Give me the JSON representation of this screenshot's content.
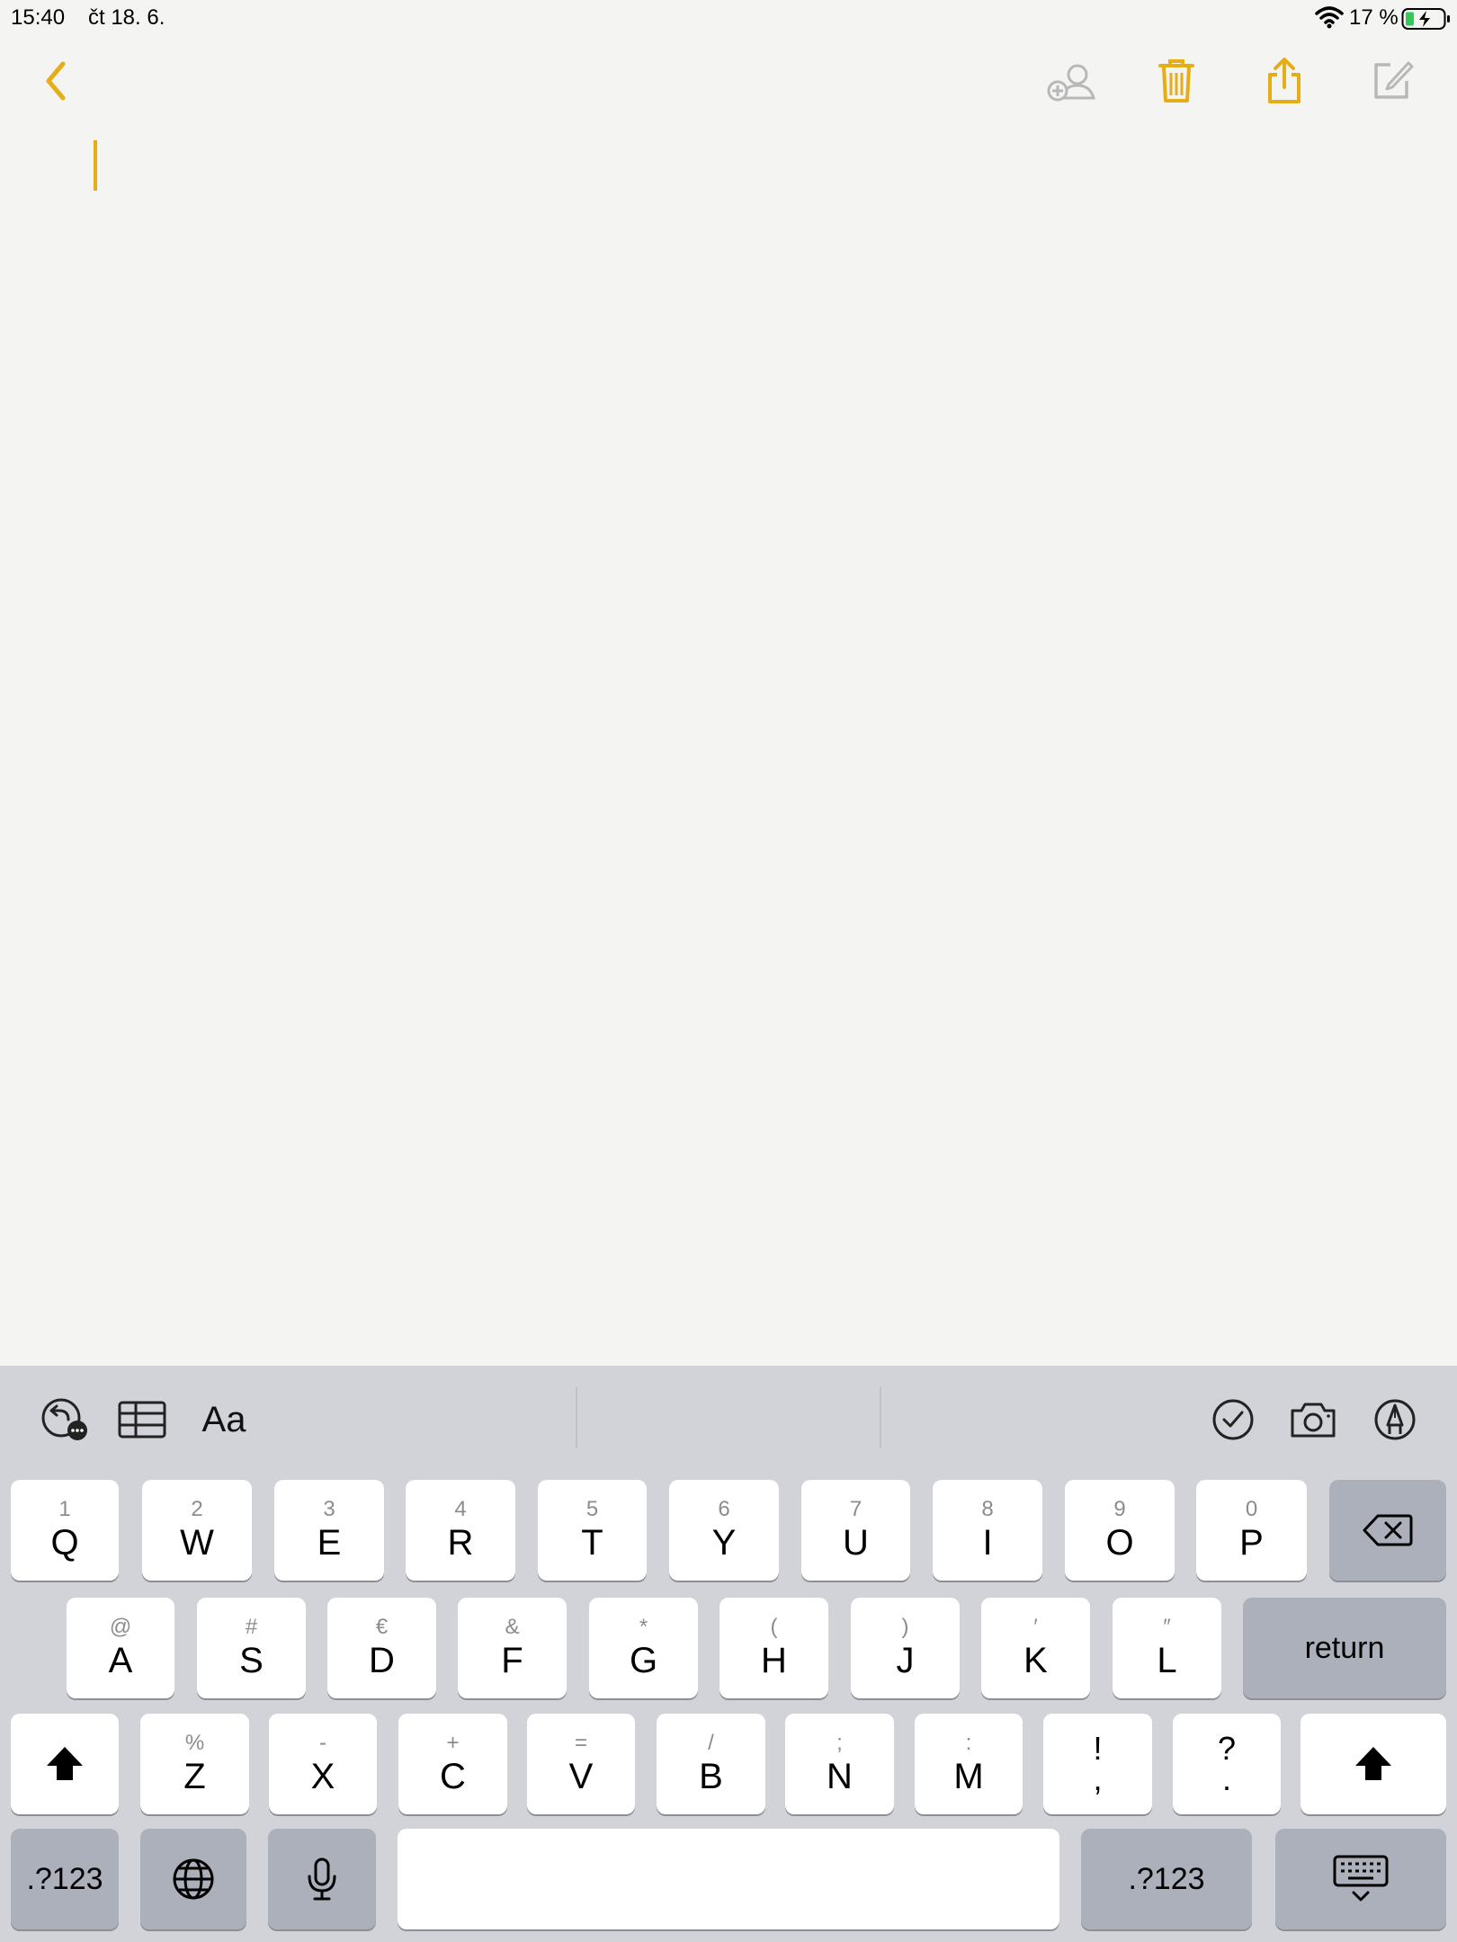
{
  "status_bar": {
    "time": "15:40",
    "date": "čt 18. 6.",
    "battery_percent": "17 %"
  },
  "nav": {
    "back_icon": "chevron-left-icon",
    "collaborate_icon": "add-person-icon",
    "trash_icon": "trash-icon",
    "share_icon": "share-icon",
    "compose_icon": "compose-icon"
  },
  "colors": {
    "accent": "#e5ad16",
    "keyboard_bg": "#d1d3d9",
    "key_bg": "#ffffff",
    "function_key_bg": "#acb0bb",
    "page_bg": "#f4f4f3"
  },
  "toolbar": {
    "format_label": "Aa"
  },
  "keyboard": {
    "row1": [
      {
        "hint": "1",
        "label": "Q"
      },
      {
        "hint": "2",
        "label": "W"
      },
      {
        "hint": "3",
        "label": "E"
      },
      {
        "hint": "4",
        "label": "R"
      },
      {
        "hint": "5",
        "label": "T"
      },
      {
        "hint": "6",
        "label": "Y"
      },
      {
        "hint": "7",
        "label": "U"
      },
      {
        "hint": "8",
        "label": "I"
      },
      {
        "hint": "9",
        "label": "O"
      },
      {
        "hint": "0",
        "label": "P"
      }
    ],
    "row2": [
      {
        "hint": "@",
        "label": "A"
      },
      {
        "hint": "#",
        "label": "S"
      },
      {
        "hint": "€",
        "label": "D"
      },
      {
        "hint": "&",
        "label": "F"
      },
      {
        "hint": "*",
        "label": "G"
      },
      {
        "hint": "(",
        "label": "H"
      },
      {
        "hint": ")",
        "label": "J"
      },
      {
        "hint": "′",
        "label": "K"
      },
      {
        "hint": "″",
        "label": "L"
      }
    ],
    "row3": [
      {
        "hint": "%",
        "label": "Z"
      },
      {
        "hint": "-",
        "label": "X"
      },
      {
        "hint": "+",
        "label": "C"
      },
      {
        "hint": "=",
        "label": "V"
      },
      {
        "hint": "/",
        "label": "B"
      },
      {
        "hint": ";",
        "label": "N"
      },
      {
        "hint": ":",
        "label": "M"
      },
      {
        "hint": "!",
        "label": ","
      },
      {
        "hint": "?",
        "label": "."
      }
    ],
    "return_label": "return",
    "numbers_label": ".?123"
  }
}
